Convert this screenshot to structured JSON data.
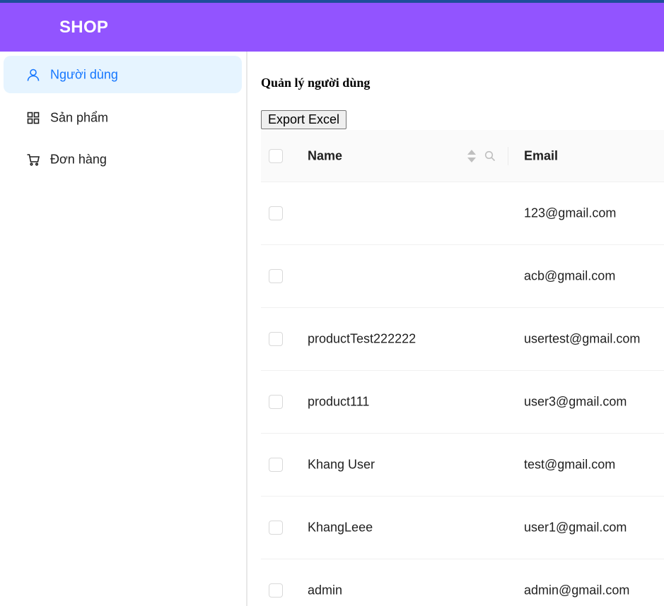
{
  "colors": {
    "header_bg": "#9254ff",
    "top_line": "#1f4e9a",
    "active_menu_bg": "#e6f4ff",
    "active_menu_text": "#1677ff"
  },
  "header": {
    "brand": "SHOP"
  },
  "sidebar": {
    "items": [
      {
        "label": "Người dùng",
        "icon": "user-icon",
        "active": true
      },
      {
        "label": "Sản phẩm",
        "icon": "appstore-icon",
        "active": false
      },
      {
        "label": "Đơn hàng",
        "icon": "shopping-cart-icon",
        "active": false
      }
    ]
  },
  "main": {
    "title": "Quản lý người dùng",
    "export_label": "Export Excel",
    "table": {
      "columns": [
        "Name",
        "Email"
      ],
      "rows": [
        {
          "name": "",
          "email": "123@gmail.com"
        },
        {
          "name": "",
          "email": "acb@gmail.com"
        },
        {
          "name": "productTest222222",
          "email": "usertest@gmail.com"
        },
        {
          "name": "product111",
          "email": "user3@gmail.com"
        },
        {
          "name": "Khang User",
          "email": "test@gmail.com"
        },
        {
          "name": "KhangLeee",
          "email": "user1@gmail.com"
        },
        {
          "name": "admin",
          "email": "admin@gmail.com"
        }
      ]
    }
  }
}
